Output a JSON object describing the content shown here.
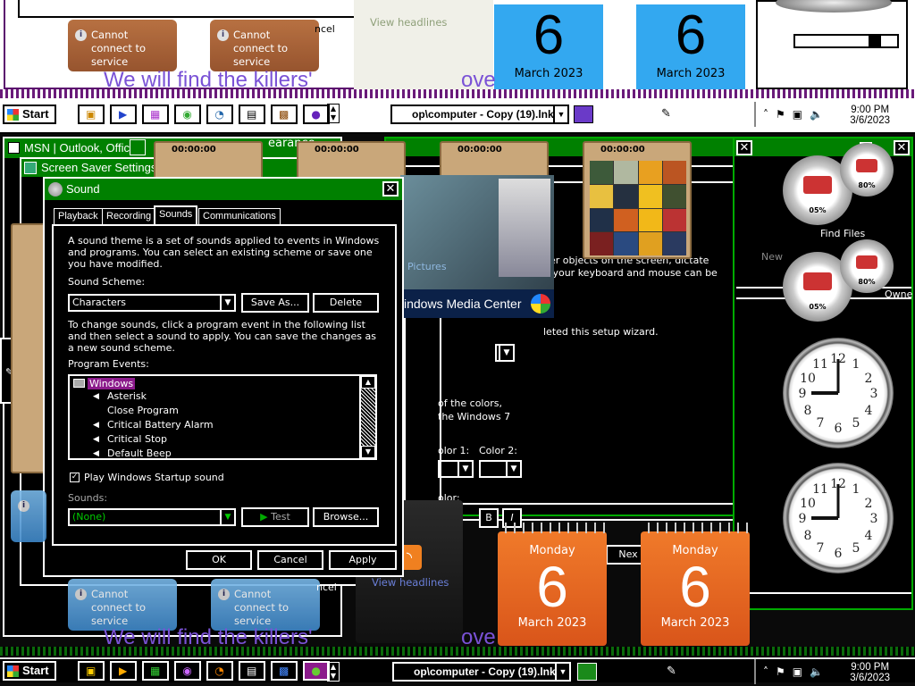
{
  "top": {
    "cannot_connect": [
      "Cannot connect to service",
      "Cannot connect to service"
    ],
    "view_headlines": "View headlines",
    "ncel": "ncel",
    "calendar": {
      "day": "6",
      "month_year": "March 2023"
    },
    "killers": "We will find the killers'",
    "killers_tail": "ove"
  },
  "taskbar": {
    "start": "Start",
    "task_item": "op\\computer - Copy (19).lnk",
    "time": "9:00 PM",
    "date": "3/6/2023"
  },
  "windows": {
    "msn_title": "MSN | Outlook, Offic",
    "screensaver_title": "Screen Saver Settings",
    "appearance_fragment": "earance"
  },
  "puzzle": {
    "time": "00:00:00"
  },
  "sound": {
    "title": "Sound",
    "tabs": [
      "Playback",
      "Recording",
      "Sounds",
      "Communications"
    ],
    "active_tab": "Sounds",
    "intro": "A sound theme is a set of sounds applied to events in Windows and programs.  You can select an existing scheme or save one you have modified.",
    "scheme_label": "Sound Scheme:",
    "scheme_value": "Characters",
    "save_as": "Save As...",
    "delete": "Delete",
    "change_text": "To change sounds, click a program event in the following list and then select a sound to apply.  You can save the changes as a new sound scheme.",
    "events_label": "Program Events:",
    "events_root": "Windows",
    "events": [
      "Asterisk",
      "Close Program",
      "Critical Battery Alarm",
      "Critical Stop",
      "Default Beep"
    ],
    "startup_checkbox": "Play Windows Startup sound",
    "sounds_label": "Sounds:",
    "sounds_value": "(None)",
    "test": "Test",
    "browse": "Browse...",
    "ok": "OK",
    "cancel": "Cancel",
    "apply": "Apply"
  },
  "bg_window": {
    "line1": "her objects on the screen, dictate",
    "line2": "h your keyboard and mouse can be",
    "wizard": "leted this setup wizard.",
    "colors1": "of the colors,",
    "colors2": "the Windows 7",
    "color1": "olor 1:",
    "color2": "Color 2:",
    "color": "olor:",
    "next": "Nex",
    "find_files": "Find Files",
    "new": "New",
    "owne": "Owne",
    "bold": "B",
    "italic": "I"
  },
  "wmc": {
    "title": "indows Media Center",
    "pictures": "Pictures"
  },
  "gadgets": {
    "gauge_a": "05%",
    "gauge_b": "80%",
    "cal": {
      "day_name": "Monday",
      "day": "6",
      "month_year": "March 2023"
    }
  },
  "bottom": {
    "cannot_connect": "Cannot connect to service",
    "ncel": "ncel",
    "view_headlines": "View headlines",
    "killers": "We will find the killers'",
    "killers_tail": "ove"
  }
}
